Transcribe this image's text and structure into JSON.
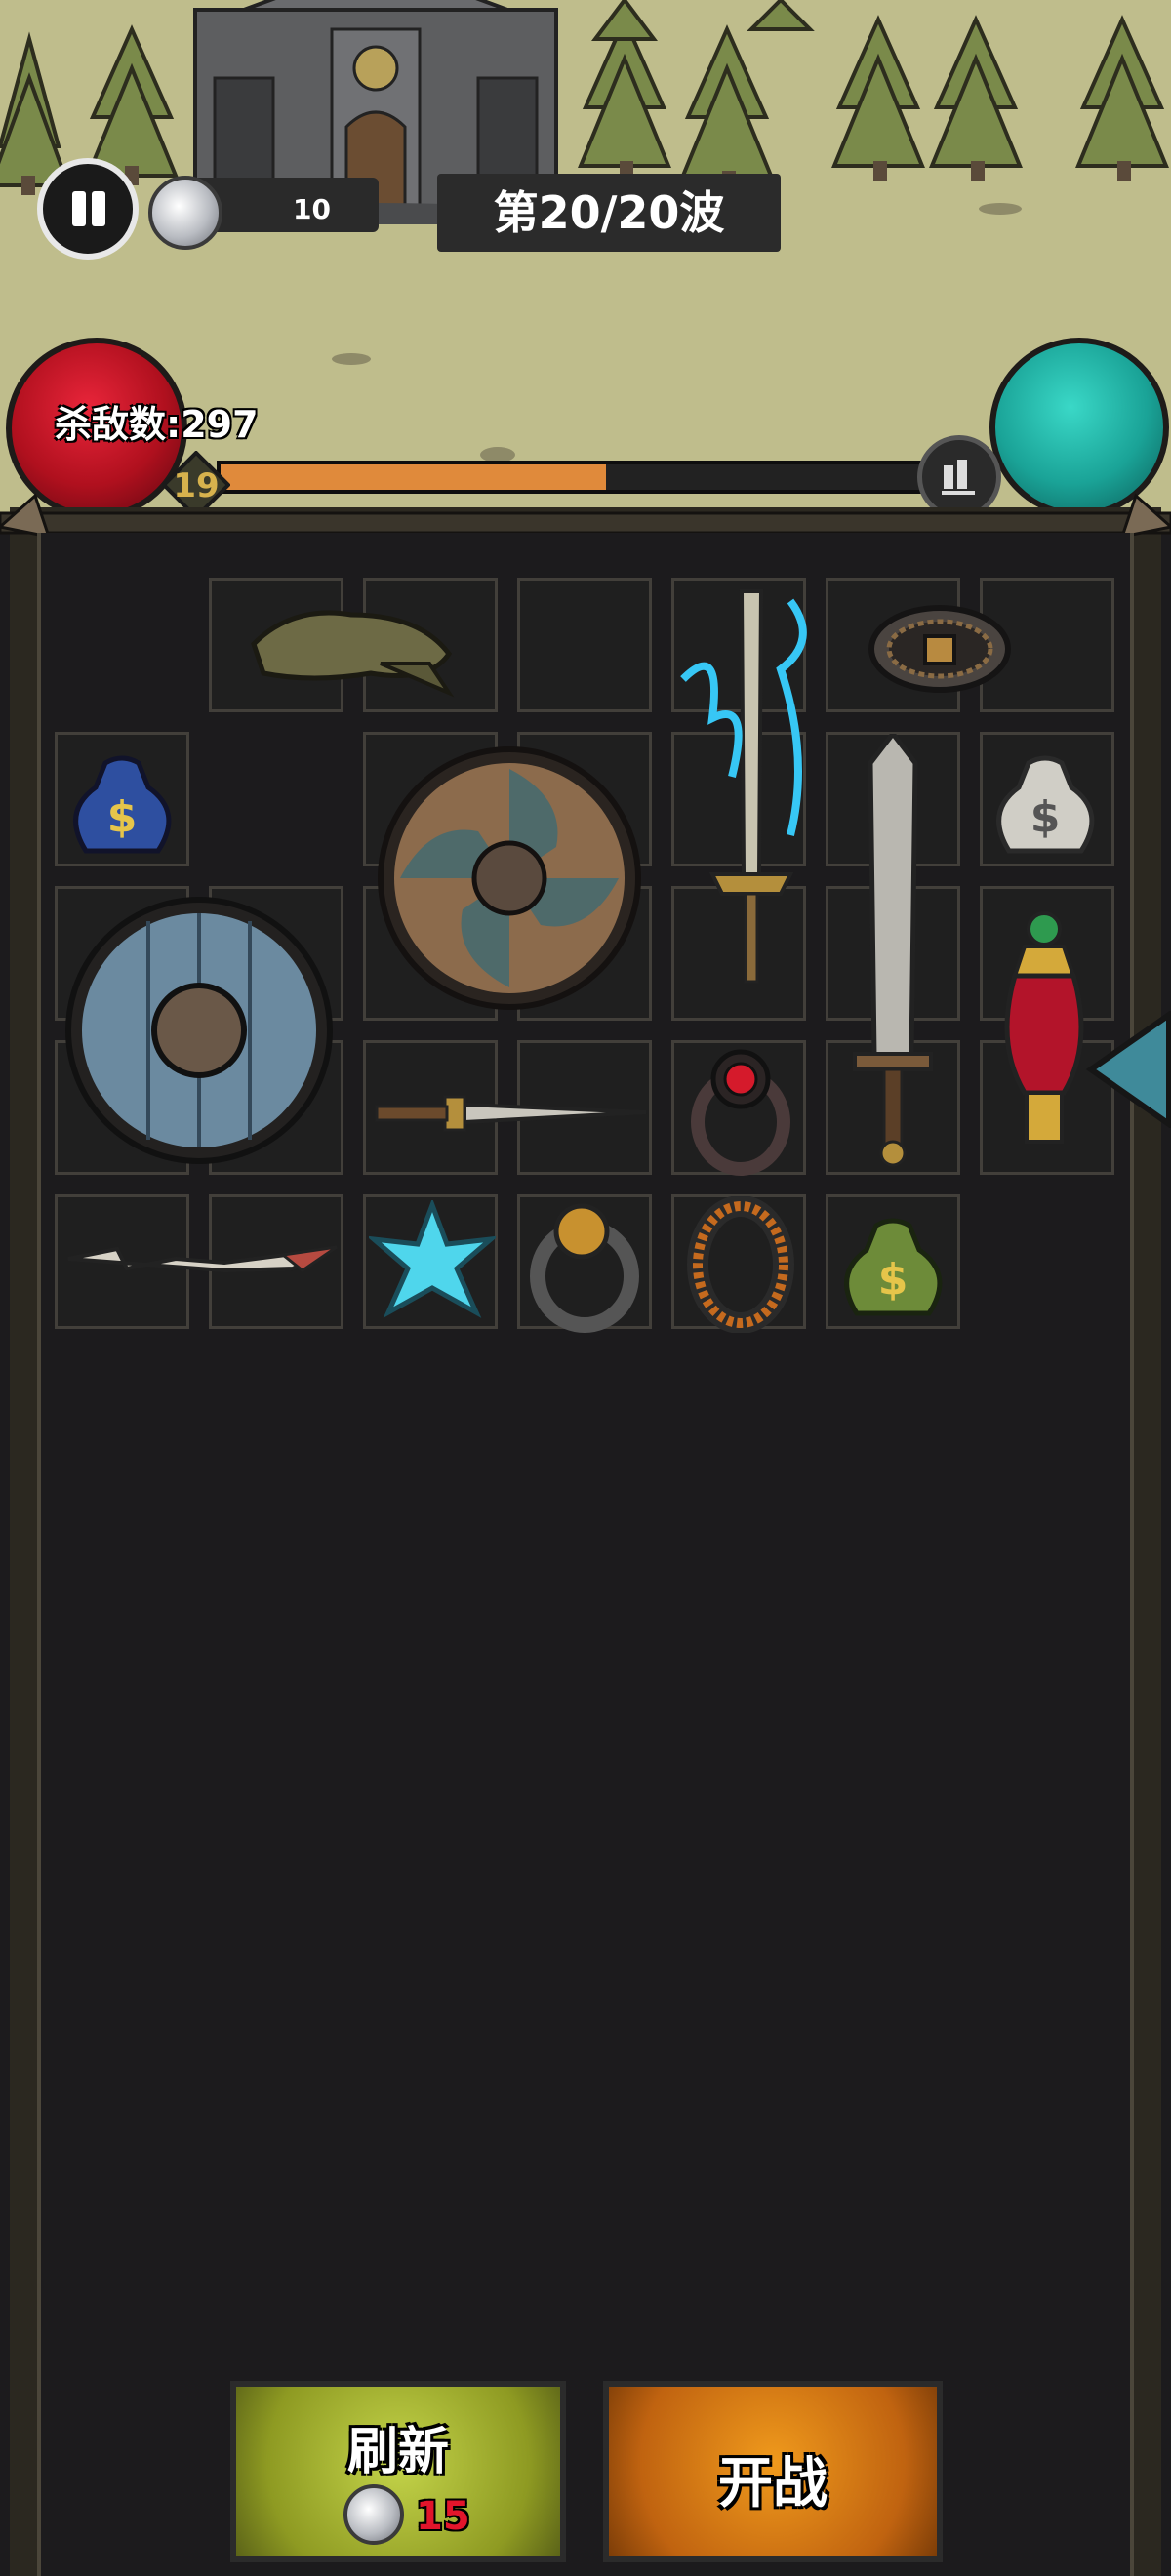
{
  "hud": {
    "coins": "10",
    "wave": "第20/20波",
    "kills": "杀敌数:297",
    "level": "19",
    "xp_progress": 0.55
  },
  "inventory": {
    "items": [
      "headband",
      "belt",
      "money-bag-blue",
      "round-shield-small",
      "lightning-sword",
      "broadsword",
      "money-bag-white",
      "round-shield-large",
      "dagger",
      "red-gem-ring",
      "potion-vial",
      "bone-sword",
      "ice-crystal",
      "gold-gem-ring",
      "orange-band-ring",
      "money-bag-green"
    ]
  },
  "buttons": {
    "refresh_label": "刷新",
    "refresh_cost": "15",
    "fight_label": "开战"
  },
  "colors": {
    "xp": "#e08a3b",
    "refresh": "#a6b52c",
    "fight": "#e07f12",
    "health_orb": "#c2121f",
    "mana_orb": "#1fb6a8"
  }
}
